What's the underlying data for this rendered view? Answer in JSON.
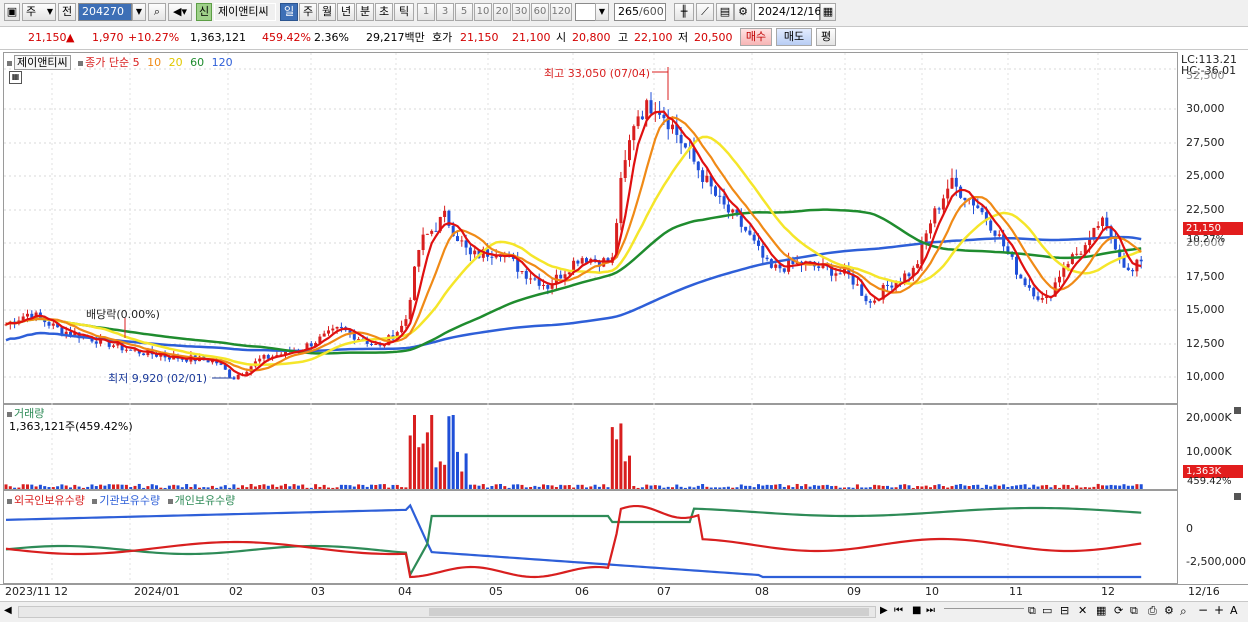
{
  "toolbar": {
    "market_type": "주",
    "prev_label": "전",
    "code": "204270",
    "credit_badge": "신",
    "stock_name": "제이앤티씨",
    "periods": [
      "일",
      "주",
      "월",
      "년",
      "분",
      "초",
      "틱"
    ],
    "active_period": "일",
    "intervals": [
      "1",
      "3",
      "5",
      "10",
      "20",
      "30",
      "60",
      "120"
    ],
    "count": "265",
    "count_max": "/600",
    "date": "2024/12/16"
  },
  "quote": {
    "price": "21,150",
    "change_arrow": "▲",
    "change": "1,970",
    "change_pct": "+10.27%",
    "volume": "1,363,121",
    "volume_ratio": "459.42%",
    "turnover": "2.36%",
    "amount": "29,217백만",
    "bid_label": "호가",
    "ask": "21,150",
    "bid": "21,100",
    "open_label": "시",
    "open": "20,800",
    "high_label": "고",
    "high": "22,100",
    "low_label": "저",
    "low": "20,500",
    "buy_button": "매수",
    "sell_button": "매도",
    "avg_button": "평"
  },
  "price_panel": {
    "stock_label": "제이앤티씨",
    "legend_prefix": "종가 단순",
    "ma_periods": [
      "5",
      "10",
      "20",
      "60",
      "120"
    ],
    "lc": "LC:113.21",
    "hc": "HC:-36.01",
    "max_annotation": "최고 33,050 (07/04)",
    "min_annotation": "최저 9,920 (02/01)",
    "dividend_annotation": "배당락(0.00%)",
    "current_tag": "21,150",
    "current_pct": "10.27%",
    "y_ticks": [
      "32,500",
      "30,000",
      "27,500",
      "25,000",
      "22,500",
      "20,000",
      "17,500",
      "15,000",
      "12,500",
      "10,000"
    ],
    "colors": {
      "up": "#d81f1f",
      "down": "#1f4fd8",
      "ma5": "#e01010",
      "ma10": "#f08a16",
      "ma20": "#f5e62a",
      "ma60": "#1f8c2e",
      "ma120": "#2e5fd8"
    }
  },
  "volume_panel": {
    "title": "거래량",
    "value": "1,363,121주(459.42%)",
    "y_ticks": [
      "20,000K",
      "10,000K"
    ],
    "tag": "1,363K",
    "tag_pct": "459.42%"
  },
  "holding_panel": {
    "legend": [
      "외국인보유수량",
      "기관보유수량",
      "개인보유수량"
    ],
    "colors": [
      "#d81f1f",
      "#2e5fd8",
      "#2e8b57"
    ],
    "y_ticks": [
      "0",
      "-2,500,000"
    ]
  },
  "x_axis": {
    "labels": [
      "2023/11",
      "12",
      "2024/01",
      "02",
      "03",
      "04",
      "05",
      "06",
      "07",
      "08",
      "09",
      "10",
      "11",
      "12"
    ],
    "end_label": "12/16"
  },
  "bottom_bar": {
    "zoom_minus": "−",
    "zoom_plus": "+",
    "font_btn": "A"
  }
}
